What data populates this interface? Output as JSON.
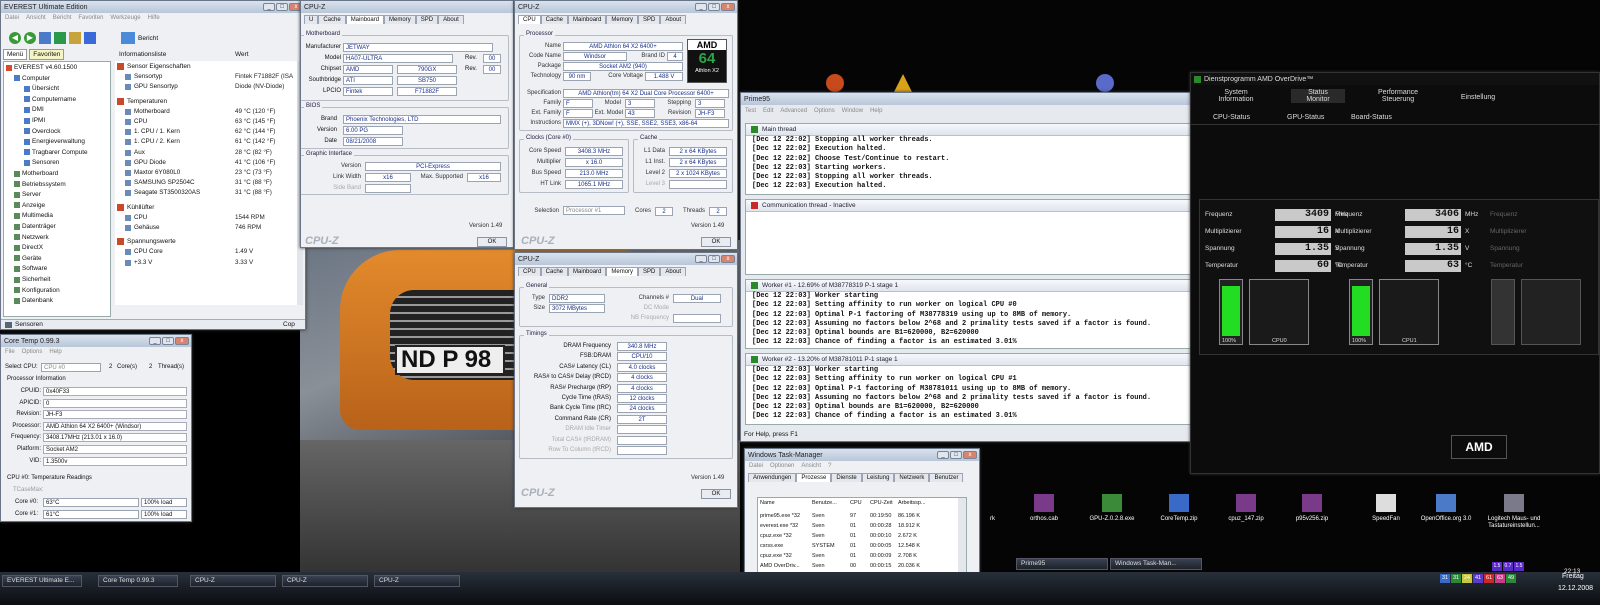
{
  "everest": {
    "title": "EVEREST Ultimate Edition",
    "menu": [
      "Datei",
      "Ansicht",
      "Bericht",
      "Favoriten",
      "Werkzeuge",
      "Hilfe"
    ],
    "report": "Bericht",
    "tab_menu": "Menü",
    "tab_fav": "Favoriten",
    "col_info": "Informationsliste",
    "col_val": "Wert",
    "tree": [
      "EVEREST v4.60.1500",
      "Computer",
      "Übersicht",
      "Computername",
      "DMI",
      "IPMI",
      "Overclock",
      "Energieverwaltung",
      "Tragbarer Compute",
      "Sensoren",
      "Motherboard",
      "Betriebssystem",
      "Server",
      "Anzeige",
      "Multimedia",
      "Datenträger",
      "Netzwerk",
      "DirectX",
      "Geräte",
      "Software",
      "Sicherheit",
      "Konfiguration",
      "Datenbank"
    ],
    "info": [
      {
        "h": "Sensor Eigenschaften"
      },
      {
        "l": "Sensortyp",
        "v": "Fintek F71882F (ISA"
      },
      {
        "l": "GPU Sensortyp",
        "v": "Diode (NV-Diode)"
      },
      {
        "h": "Temperaturen"
      },
      {
        "l": "Motherboard",
        "v": "49 °C  (120 °F)"
      },
      {
        "l": "CPU",
        "v": "63 °C  (145 °F)"
      },
      {
        "l": "1. CPU / 1. Kern",
        "v": "62 °C  (144 °F)"
      },
      {
        "l": "1. CPU / 2. Kern",
        "v": "61 °C  (142 °F)"
      },
      {
        "l": "Aux",
        "v": "28 °C  (82 °F)"
      },
      {
        "l": "GPU Diode",
        "v": "41 °C  (106 °F)"
      },
      {
        "l": "Maxtor 6Y080L0",
        "v": "23 °C  (73 °F)"
      },
      {
        "l": "SAMSUNG SP2504C",
        "v": "31 °C  (88 °F)"
      },
      {
        "l": "Seagate ST3500320AS",
        "v": "31 °C  (88 °F)"
      },
      {
        "h": "Kühllüfter"
      },
      {
        "l": "CPU",
        "v": "1544 RPM"
      },
      {
        "l": "Gehäuse",
        "v": "746 RPM"
      },
      {
        "h": "Spannungswerte"
      },
      {
        "l": "CPU Core",
        "v": "1.49 V"
      },
      {
        "l": "+3.3 V",
        "v": "3.33 V"
      }
    ],
    "status_left": "Sensoren",
    "status_right": "Cop"
  },
  "coretemp": {
    "title": "Core Temp 0.99.3",
    "menu": [
      "File",
      "Options",
      "Help"
    ],
    "select_cpu": "Select CPU:",
    "cpu_sel": "CPU #0",
    "cores_n": "2",
    "cores": "Core(s)",
    "threads_n": "2",
    "threads": "Thread(s)",
    "proc_info": "Processor Information",
    "fields": [
      {
        "l": "CPUID:",
        "v": "0x40F33"
      },
      {
        "l": "APICID:",
        "v": "0"
      },
      {
        "l": "Revision:",
        "v": "JH-F3"
      },
      {
        "l": "Processor:",
        "v": "AMD Athlon 64 X2 6400+ (Windsor)"
      },
      {
        "l": "Frequency:",
        "v": "3408.17MHz (213.01 x 16.0)"
      },
      {
        "l": "Platform:",
        "v": "Socket AM2"
      },
      {
        "l": "VID:",
        "v": "1.3500v"
      }
    ],
    "temp_hdr": "CPU #0: Temperature Readings",
    "tcase": "TCaseMax:",
    "core0": "Core #0:",
    "core0_t": "63°C",
    "core0_l": "100% load",
    "core1": "Core #1:",
    "core1_t": "61°C",
    "core1_l": "100% load"
  },
  "cpuz_mb": {
    "title": "CPU-Z",
    "tabs": [
      "U",
      "Cache",
      "Mainboard",
      "Memory",
      "SPD",
      "About"
    ],
    "grp_mb": "Motherboard",
    "rows": [
      {
        "l": "Manufacturer",
        "v": "JETWAY"
      },
      {
        "l": "Model",
        "v": "HA07-ULTRA",
        "rev_l": "Rev.",
        "rev": "00"
      },
      {
        "l": "Chipset",
        "v": "AMD",
        "v2": "790GX",
        "r2l": "Rev.",
        "r2": "00"
      },
      {
        "l": "Southbridge",
        "v": "ATI",
        "v2": "SB750"
      },
      {
        "l": "LPCIO",
        "v": "Fintek",
        "v2": "F71882F"
      }
    ],
    "grp_bios": "BIOS",
    "bios": [
      {
        "l": "Brand",
        "v": "Phoenix Technologies, LTD"
      },
      {
        "l": "Version",
        "v": "6.00 PG"
      },
      {
        "l": "Date",
        "v": "08/21/2008"
      }
    ],
    "grp_gfx": "Graphic Interface",
    "gfx_ver_l": "Version",
    "gfx_ver": "PCI-Express",
    "lw_l": "Link Width",
    "lw": "x16",
    "ms_l": "Max. Supported",
    "ms": "x16",
    "sb_l": "Side Band",
    "version": "Version 1.49",
    "ok": "OK",
    "brand": "CPU-Z"
  },
  "cpuz_cpu": {
    "title": "CPU-Z",
    "tabs": [
      "CPU",
      "Cache",
      "Mainboard",
      "Memory",
      "SPD",
      "About"
    ],
    "grp_proc": "Processor",
    "name_l": "Name",
    "name": "AMD Athlon 64 X2 6400+",
    "code_l": "Code Name",
    "code": "Windsor",
    "bid_l": "Brand ID",
    "bid": "4",
    "pkg_l": "Package",
    "pkg": "Socket AM2 (940)",
    "tech_l": "Technology",
    "tech": "90 nm",
    "cv_l": "Core Voltage",
    "cv": "1.488 V",
    "spec_l": "Specification",
    "spec": "AMD Athlon(tm) 64 X2 Dual Core Processor 6400+",
    "fam_l": "Family",
    "fam": "F",
    "mod_l": "Model",
    "mod": "3",
    "step_l": "Stepping",
    "step": "3",
    "efam_l": "Ext. Family",
    "efam": "F",
    "emod_l": "Ext. Model",
    "emod": "43",
    "rev_l": "Revision",
    "rev": "JH-F3",
    "ins_l": "Instructions",
    "ins": "MMX (+), 3DNow! (+), SSE, SSE2, SSE3, x86-64",
    "grp_clk": "Clocks (Core #0)",
    "cs_l": "Core Speed",
    "cs": "3408.3 MHz",
    "mul_l": "Multiplier",
    "mul": "x 16.0",
    "bus_l": "Bus Speed",
    "bus": "213.0 MHz",
    "ht_l": "HT Link",
    "ht": "1065.1 MHz",
    "grp_cache": "Cache",
    "l1d_l": "L1 Data",
    "l1d": "2 x 64 KBytes",
    "l1i_l": "L1 Inst.",
    "l1i": "2 x 64 KBytes",
    "l2_l": "Level 2",
    "l2": "2 x 1024 KBytes",
    "l3_l": "Level 3",
    "sel_l": "Selection",
    "sel": "Processor #1",
    "cores_l": "Cores",
    "cores": "2",
    "thr_l": "Threads",
    "thr": "2",
    "logo_top": "AMD",
    "logo_bot": "Athlon X2",
    "version": "Version 1.49",
    "ok": "OK",
    "brand": "CPU-Z"
  },
  "cpuz_mem": {
    "title": "CPU-Z",
    "tabs": [
      "CPU",
      "Cache",
      "Mainboard",
      "Memory",
      "SPD",
      "About"
    ],
    "grp_gen": "General",
    "type_l": "Type",
    "type": "DDR2",
    "ch_l": "Channels #",
    "ch": "Dual",
    "size_l": "Size",
    "size": "3072 MBytes",
    "dc_l": "DC Mode",
    "nb_l": "NB Frequency",
    "grp_tim": "Timings",
    "timings": [
      {
        "l": "DRAM Frequency",
        "v": "340.8 MHz"
      },
      {
        "l": "FSB:DRAM",
        "v": "CPU/10"
      },
      {
        "l": "CAS# Latency (CL)",
        "v": "4.0 clocks"
      },
      {
        "l": "RAS# to CAS# Delay (tRCD)",
        "v": "4 clocks"
      },
      {
        "l": "RAS# Precharge (tRP)",
        "v": "4 clocks"
      },
      {
        "l": "Cycle Time (tRAS)",
        "v": "12 clocks"
      },
      {
        "l": "Bank Cycle Time (tRC)",
        "v": "24 clocks"
      },
      {
        "l": "Command Rate (CR)",
        "v": "2T"
      },
      {
        "l": "DRAM Idle Timer",
        "v": ""
      },
      {
        "l": "Total CAS# (tRDRAM)",
        "v": ""
      },
      {
        "l": "Row To Column (tRCD)",
        "v": ""
      }
    ],
    "version": "Version 1.49",
    "ok": "OK",
    "brand": "CPU-Z"
  },
  "prime": {
    "title": "Prime95",
    "menu": [
      "Test",
      "Edit",
      "Advanced",
      "Options",
      "Window",
      "Help"
    ],
    "main_title": "Main thread",
    "main": [
      "[Dec 12 22:02] Stopping all worker threads.",
      "[Dec 12 22:02] Execution halted.",
      "[Dec 12 22:02] Choose Test/Continue to restart.",
      "[Dec 12 22:03] Starting workers.",
      "[Dec 12 22:03] Stopping all worker threads.",
      "[Dec 12 22:03] Execution halted."
    ],
    "comm_title": "Communication thread - Inactive",
    "w1_title": "Worker #1 - 12.69% of M38778319 P-1 stage 1",
    "w1": [
      "[Dec 12 22:03] Worker starting",
      "[Dec 12 22:03] Setting affinity to run worker on logical CPU #0",
      "[Dec 12 22:03] Optimal P-1 factoring of M38778319 using up to 8MB of memory.",
      "[Dec 12 22:03] Assuming no factors below 2^68 and 2 primality tests saved if a factor is found.",
      "[Dec 12 22:03] Optimal bounds are B1=620000, B2=620000",
      "[Dec 12 22:03] Chance of finding a factor is an estimated 3.01%"
    ],
    "w2_title": "Worker #2 - 13.20% of M38781011 P-1 stage 1",
    "w2": [
      "[Dec 12 22:03] Worker starting",
      "[Dec 12 22:03] Setting affinity to run worker on logical CPU #1",
      "[Dec 12 22:03] Optimal P-1 factoring of M38781011 using up to 8MB of memory.",
      "[Dec 12 22:03] Assuming no factors below 2^68 and 2 primality tests saved if a factor is found.",
      "[Dec 12 22:03] Optimal bounds are B1=620000, B2=620000",
      "[Dec 12 22:03] Chance of finding a factor is an estimated 3.01%"
    ],
    "status": "For Help, press F1"
  },
  "amd": {
    "title": "Dienstprogramm AMD OverDrive™",
    "nav": [
      "System\nInformation",
      "Status\nMonitor",
      "Performance\nSteuerung",
      "Einstellung"
    ],
    "sub": [
      "CPU-Status",
      "GPU-Status",
      "Board-Status"
    ],
    "labels": [
      "Frequenz",
      "Multiplizierer",
      "Spannung",
      "Temperatur"
    ],
    "units": [
      "MHz",
      "X",
      "V",
      "°C"
    ],
    "cpu0": [
      "3409",
      "16",
      "1.35",
      "60"
    ],
    "cpu1": [
      "3406",
      "16",
      "1.35",
      "63"
    ],
    "bar0": "100%",
    "bar1": "100%",
    "cpu0_l": "CPU0",
    "cpu1_l": "CPU1",
    "logo": "AMD"
  },
  "taskman": {
    "title": "Windows Task-Manager",
    "menu": [
      "Datei",
      "Optionen",
      "Ansicht",
      "?"
    ],
    "tabs": [
      "Anwendungen",
      "Prozesse",
      "Dienste",
      "Leistung",
      "Netzwerk",
      "Benutzer"
    ],
    "cols": [
      "Name",
      "Benutze...",
      "CPU",
      "CPU-Zeit",
      "Arbeitssp..."
    ],
    "rows": [
      [
        "prime95.exe *32",
        "Sven",
        "97",
        "00:19:50",
        "86.196 K"
      ],
      [
        "everest.exe *32",
        "Sven",
        "01",
        "00:00:28",
        "18.912 K"
      ],
      [
        "cpuz.exe *32",
        "Sven",
        "01",
        "00:00:10",
        "2.672 K"
      ],
      [
        "csrss.exe",
        "SYSTEM",
        "01",
        "00:00:05",
        "12.548 K"
      ],
      [
        "cpuz.exe *32",
        "Sven",
        "01",
        "00:00:09",
        "2.708 K"
      ],
      [
        "AMD OverDriv...",
        "Sven",
        "00",
        "00:00:15",
        "20.036 K"
      ],
      [
        "taskmgr.exe",
        "Sven",
        "00",
        "00:00:05",
        "3.192 K"
      ],
      [
        "KHALMNPR.exe",
        "Sven",
        "00",
        "00:00:01",
        "4.972 K"
      ]
    ]
  },
  "desktop": {
    "icons": [
      "orthos.cab",
      "GPU-Z.0.2.8.exe",
      "CoreTemp.zip",
      "cpuz_147.zip",
      "p95v256.zip",
      "SpeedFan",
      "OpenOffice.org 3.0",
      "Logitech Maus- und Tastatureinstellun..."
    ],
    "partial": "rk"
  },
  "taskbar": {
    "items": [
      "EVEREST Ultimate E...",
      "Core Temp 0.99.3",
      "CPU-Z",
      "CPU-Z",
      "CPU-Z",
      "Prime95",
      "Windows Task-Man..."
    ],
    "tray_nums": [
      "31",
      "31",
      "24",
      "41",
      "61",
      "63",
      "49"
    ],
    "tray_top": [
      "1.5",
      "0.7",
      "1.5"
    ],
    "time": "22:13",
    "day": "Freitag",
    "date": "12.12.2008"
  },
  "colors": {
    "accent": "#1a2f8a",
    "amd_bg": "#0c0c0c",
    "value_gray": "#c9c9c9",
    "bar_green": "#22dd22"
  }
}
